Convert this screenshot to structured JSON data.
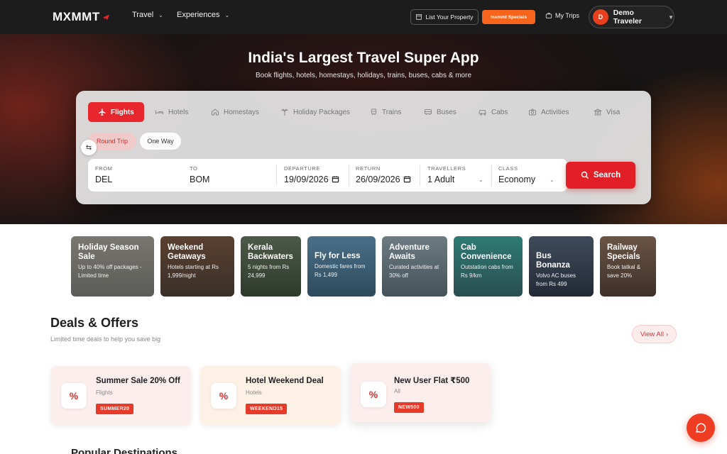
{
  "header": {
    "logo_text": "MXMMT",
    "nav": [
      {
        "label": "Travel"
      },
      {
        "label": "Experiences"
      }
    ],
    "list_property_label": "List Your Property",
    "specials_label": "mxmmt Specials",
    "my_trips_label": "My Trips",
    "user": {
      "initial": "D",
      "name": "Demo Traveler"
    }
  },
  "hero": {
    "title": "India's Largest Travel Super App",
    "subtitle": "Book flights, hotels, homestays, holidays, trains, buses, cabs & more"
  },
  "search": {
    "tabs": [
      {
        "label": "Flights",
        "icon": "plane-icon",
        "active": true
      },
      {
        "label": "Hotels",
        "icon": "bed-icon"
      },
      {
        "label": "Homestays",
        "icon": "home-icon"
      },
      {
        "label": "Holiday Packages",
        "icon": "palm-icon"
      },
      {
        "label": "Trains",
        "icon": "train-icon"
      },
      {
        "label": "Buses",
        "icon": "bus-icon"
      },
      {
        "label": "Cabs",
        "icon": "car-icon"
      },
      {
        "label": "Activities",
        "icon": "camera-icon"
      },
      {
        "label": "Visa",
        "icon": "bank-icon"
      }
    ],
    "trip_types": {
      "round": "Round Trip",
      "one": "One Way"
    },
    "from": {
      "label": "FROM",
      "value": "DEL"
    },
    "to": {
      "label": "TO",
      "value": "BOM"
    },
    "departure": {
      "label": "DEPARTURE",
      "value": "19/09/2026"
    },
    "return": {
      "label": "RETURN",
      "value": "26/09/2026"
    },
    "travellers": {
      "label": "TRAVELLERS",
      "value": "1 Adult"
    },
    "class": {
      "label": "CLASS",
      "value": "Economy"
    },
    "button_label": "Search"
  },
  "promos": [
    {
      "title": "Holiday Season Sale",
      "sub": "Up to 40% off packages - Limited time",
      "bg": "#6d6d68"
    },
    {
      "title": "Weekend Getaways",
      "sub": "Hotels starting at Rs 1,999/night",
      "bg": "#4a3a2e"
    },
    {
      "title": "Kerala Backwaters",
      "sub": "5 nights from Rs 24,999",
      "bg": "#3b4a3a"
    },
    {
      "title": "Fly for Less",
      "sub": "Domestic fares from Rs 1,499",
      "bg": "#3d6278"
    },
    {
      "title": "Adventure Awaits",
      "sub": "Curated activities at 30% off",
      "bg": "#5b6a72"
    },
    {
      "title": "Cab Convenience",
      "sub": "Outstation cabs from Rs 9/km",
      "bg": "#2e6a66"
    },
    {
      "title": "Bus Bonanza",
      "sub": "Volvo AC buses from Rs 499",
      "bg": "#3c4656"
    },
    {
      "title": "Railway Specials",
      "sub": "Book tatkal & save 20%",
      "bg": "#5a4a40"
    }
  ],
  "deals": {
    "title": "Deals & Offers",
    "subtitle": "Limited time deals to help you save big",
    "view_all": "View All",
    "items": [
      {
        "title": "Summer Sale 20% Off",
        "category": "Flights",
        "code": "SUMMER20",
        "bg": "#fdeeee"
      },
      {
        "title": "Hotel Weekend Deal",
        "category": "Hotels",
        "code": "WEEKEND15",
        "bg": "#fdf1e6"
      },
      {
        "title": "New User Flat ₹500",
        "category": "All",
        "code": "NEW500",
        "bg": "#fdeeee"
      }
    ]
  },
  "popular_title": "Popular Destinations",
  "colors": {
    "brand_red": "#e8262d",
    "orange": "#f7641b"
  }
}
